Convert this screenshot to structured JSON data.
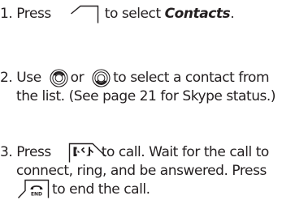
{
  "steps": [
    {
      "number": "1.",
      "press": "Press",
      "after_icon": "to select",
      "target": "Contacts",
      "end": ".",
      "icon": "softkey-icon"
    },
    {
      "number": "2.",
      "use": "Use",
      "or": "or",
      "after_icons": "to select a contact from",
      "line2": "the list. (See page 21 for Skype status.)",
      "icons": [
        "nav-up-icon",
        "nav-down-icon"
      ]
    },
    {
      "number": "3.",
      "press": "Press",
      "after_icon": "to call. Wait for the call to",
      "line2": "connect, ring, and be answered. Press",
      "line3_after_icon": "to end the call.",
      "icons": [
        "talk-key-icon",
        "end-key-icon"
      ],
      "end_key_label": "END"
    }
  ],
  "colors": {
    "text": "#231f20"
  }
}
